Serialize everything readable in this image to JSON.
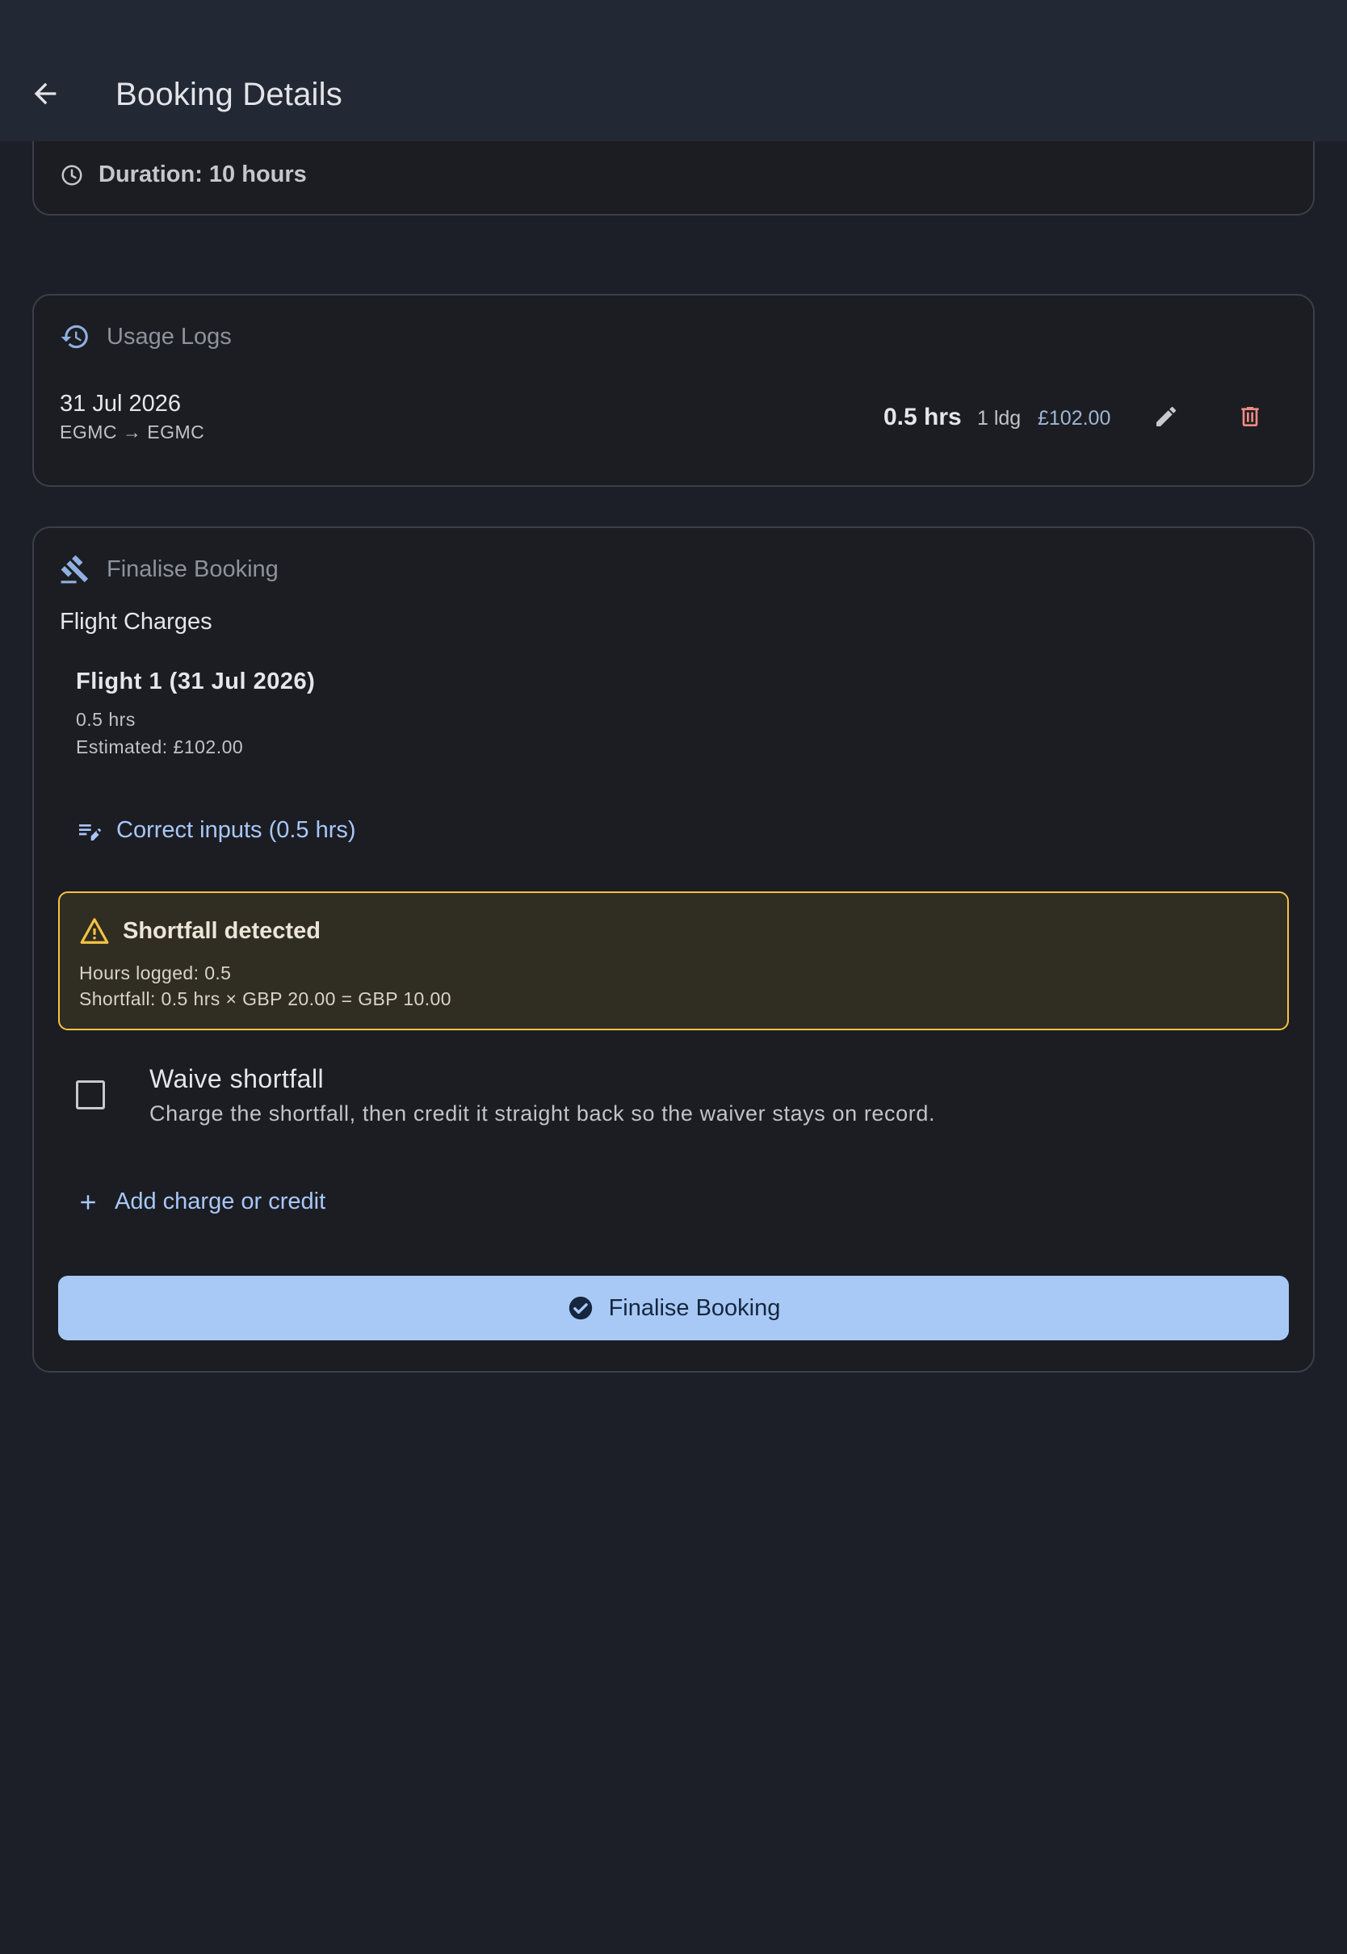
{
  "header": {
    "title": "Booking Details",
    "back_icon": "arrow-back-icon"
  },
  "booking_summary": {
    "duration": "Duration: 10 hours"
  },
  "usage_logs": {
    "title": "Usage Logs",
    "entries": [
      {
        "date": "31 Jul 2026",
        "route": "EGMC → EGMC",
        "hours": "0.5 hrs",
        "landings": "1 ldg",
        "cost": "£102.00"
      }
    ]
  },
  "finalise": {
    "title": "Finalise Booking",
    "flight_charges_label": "Flight Charges",
    "flights": [
      {
        "title": "Flight 1 (31 Jul 2026)",
        "hours": "0.5 hrs",
        "estimated": "Estimated: £102.00"
      }
    ],
    "correct_inputs_label": "Correct inputs (0.5 hrs)",
    "shortfall": {
      "title": "Shortfall detected",
      "hours_logged": "Hours logged: 0.5",
      "calculation": "Shortfall: 0.5 hrs × GBP 20.00 = GBP 10.00"
    },
    "waive": {
      "checked": false,
      "title": "Waive shortfall",
      "description": "Charge the shortfall, then credit it straight back so the waiver stays on record."
    },
    "add_charge_label": "Add charge or credit",
    "submit_label": "Finalise Booking"
  },
  "colors": {
    "background": "#1c1f28",
    "app_bar": "#232835",
    "accent": "#a8c7fa",
    "warning": "#f5c342",
    "danger": "#f28b82"
  }
}
